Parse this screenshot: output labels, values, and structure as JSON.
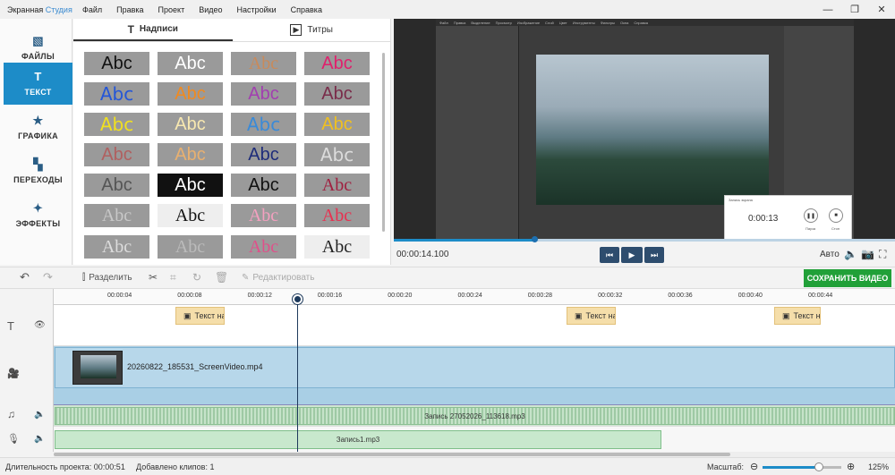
{
  "app": {
    "name_part1": "Экранная ",
    "name_part2": "Студия"
  },
  "menu": [
    "Файл",
    "Правка",
    "Проект",
    "Видео",
    "Настройки",
    "Справка"
  ],
  "window_buttons": [
    "—",
    "❐",
    "✕"
  ],
  "sidebar": [
    {
      "label": "ФАЙЛЫ",
      "icon": "image-icon",
      "glyph": "▧"
    },
    {
      "label": "ТЕКСТ",
      "icon": "text-icon",
      "glyph": "T"
    },
    {
      "label": "ГРАФИКА",
      "icon": "star-icon",
      "glyph": "★"
    },
    {
      "label": "ПЕРЕХОДЫ",
      "icon": "transitions-icon",
      "glyph": "▚"
    },
    {
      "label": "ЭФФЕКТЫ",
      "icon": "magic-wand-icon",
      "glyph": "✦"
    }
  ],
  "panel": {
    "tabs": [
      {
        "label": "Надписи",
        "glyph": "T"
      },
      {
        "label": "Титры",
        "glyph": "▶"
      }
    ],
    "tile_text": "Abc",
    "tiles": [
      {
        "color": "#111",
        "bg": "#9a9a9a",
        "font": "Liberation Sans"
      },
      {
        "color": "#fff",
        "bg": "#9a9a9a",
        "font": "Liberation Sans"
      },
      {
        "color": "#c98a5a",
        "bg": "#9a9a9a",
        "font": "Liberation Serif"
      },
      {
        "color": "#e0206c",
        "bg": "#9a9a9a",
        "font": "Liberation Sans"
      },
      {
        "color": "#2456d8",
        "bg": "#9a9a9a",
        "font": "DejaVu Sans"
      },
      {
        "color": "#f08a20",
        "bg": "#9a9a9a",
        "font": "Liberation Sans"
      },
      {
        "color": "#a23fb0",
        "bg": "#9a9a9a",
        "font": "Liberation Sans"
      },
      {
        "color": "#7a2c4a",
        "bg": "#9a9a9a",
        "font": "Liberation Sans"
      },
      {
        "color": "#f0e020",
        "bg": "#9a9a9a",
        "font": "DejaVu Sans"
      },
      {
        "color": "#f8e8b0",
        "bg": "#9a9a9a",
        "font": "Liberation Sans"
      },
      {
        "color": "#3a8ad8",
        "bg": "#9a9a9a",
        "font": "DejaVu Sans"
      },
      {
        "color": "#f0c020",
        "bg": "#9a9a9a",
        "font": "Liberation Sans"
      },
      {
        "color": "#b06060",
        "bg": "#9a9a9a",
        "font": "Liberation Sans"
      },
      {
        "color": "#e8b070",
        "bg": "#9a9a9a",
        "font": "Liberation Sans"
      },
      {
        "color": "#1e2c7a",
        "bg": "#9a9a9a",
        "font": "Liberation Sans"
      },
      {
        "color": "#dcdcdc",
        "bg": "#9a9a9a",
        "font": "DejaVu Sans"
      },
      {
        "color": "#555",
        "bg": "#9a9a9a",
        "font": "Liberation Sans"
      },
      {
        "color": "#fff",
        "bg": "#111",
        "font": "Liberation Sans"
      },
      {
        "color": "#111",
        "bg": "#9a9a9a",
        "font": "Liberation Sans"
      },
      {
        "color": "#a02040",
        "bg": "#9a9a9a",
        "font": "Liberation Serif"
      },
      {
        "color": "#c8c8c8",
        "bg": "#9a9a9a",
        "font": "Liberation Serif"
      },
      {
        "color": "#111",
        "bg": "#eee",
        "font": "Liberation Serif"
      },
      {
        "color": "#f4a0c0",
        "bg": "#9a9a9a",
        "font": "Liberation Serif"
      },
      {
        "color": "#e83050",
        "bg": "#9a9a9a",
        "font": "Liberation Serif"
      },
      {
        "color": "#ddd",
        "bg": "#9a9a9a",
        "font": "Liberation Serif"
      },
      {
        "color": "#bbb",
        "bg": "#9a9a9a",
        "font": "Liberation Serif"
      },
      {
        "color": "#e0508a",
        "bg": "#9a9a9a",
        "font": "Liberation Serif"
      },
      {
        "color": "#222",
        "bg": "#eee",
        "font": "Liberation Serif"
      }
    ]
  },
  "preview": {
    "gimp_menu": [
      "Файл",
      "Правка",
      "Выделение",
      "Просмотр",
      "Изображение",
      "Слой",
      "Цвет",
      "Инструменты",
      "Фильтры",
      "Окна",
      "Справка"
    ],
    "recorder": {
      "title": "Запись экрана",
      "time": "0:00:13",
      "pause": "Пауза",
      "stop": "Стоп"
    },
    "progress_fraction": 0.28
  },
  "playback": {
    "time": "00:00:14.100",
    "auto": "Авто",
    "buttons": [
      {
        "name": "prev-frame-button",
        "glyph": "⏮"
      },
      {
        "name": "play-button",
        "glyph": "▶"
      },
      {
        "name": "next-frame-button",
        "glyph": "⏭"
      }
    ]
  },
  "toolbar": {
    "split": "Разделить",
    "edit": "Редактировать",
    "save": "СОХРАНИТЬ ВИДЕО"
  },
  "timeline": {
    "ticks": [
      "00:00:04",
      "00:00:08",
      "00:00:12",
      "00:00:16",
      "00:00:20",
      "00:00:24",
      "00:00:28",
      "00:00:32",
      "00:00:36",
      "00:00:40",
      "00:00:44"
    ],
    "text_clip_label": "Текст на",
    "video_clip": "20260822_185531_ScreenVideo.mp4",
    "audio_clip1": "Запись 27052026_113618.mp3",
    "audio_clip2": "Запись1.mp3"
  },
  "status": {
    "duration": "Длительность проекта: 00:00:51",
    "clips": "Добавлено клипов: 1",
    "scale": "Масштаб:",
    "zoom": "125%"
  }
}
